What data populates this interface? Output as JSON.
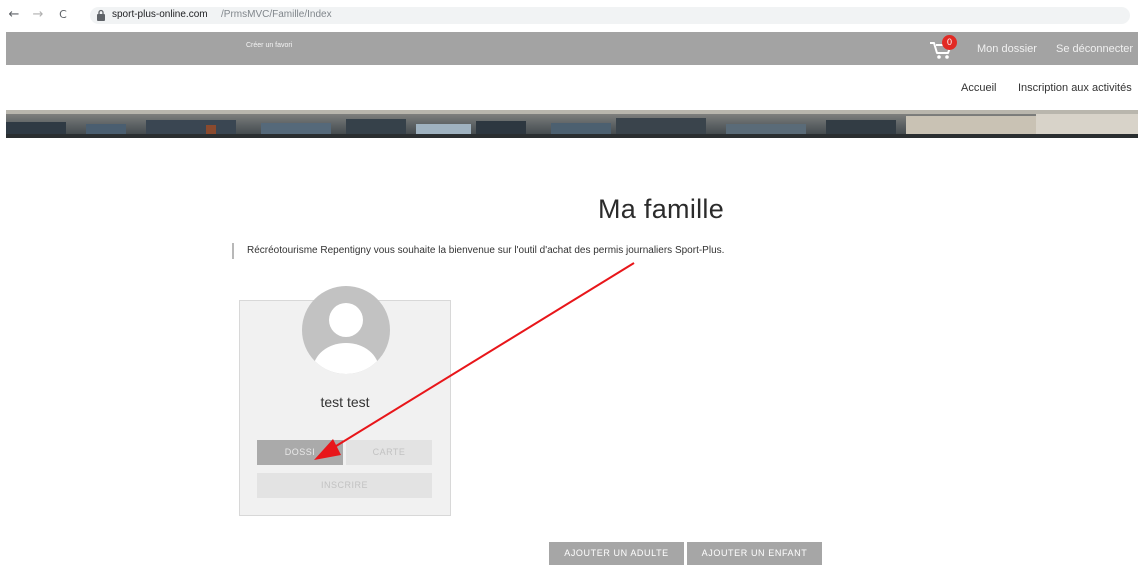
{
  "browser": {
    "back": "←",
    "forward": "→",
    "reload": "C",
    "url_host": "sport-plus-online.com",
    "url_path": "/PrmsMVC/Famille/Index"
  },
  "topbar": {
    "favorite_link": "Créer un favori",
    "cart_count": "0",
    "mon_dossier": "Mon dossier",
    "logout": "Se déconnecter"
  },
  "subnav": {
    "home": "Accueil",
    "activities": "Inscription aux activités"
  },
  "page": {
    "title": "Ma famille",
    "intro": "Récréotourisme Repentigny vous souhaite la bienvenue sur  l'outil d'achat des permis journaliers Sport-Plus."
  },
  "member": {
    "name": "test test",
    "dossier_label": "DOSSI",
    "carte_label": "CARTE",
    "inscrire_label": "INSCRIRE"
  },
  "actions": {
    "add_adult": "AJOUTER UN ADULTE",
    "add_child": "AJOUTER UN ENFANT"
  },
  "colors": {
    "topbar": "#a3a3a3",
    "badge": "#e12a24",
    "annotation_arrow": "#e8161a"
  }
}
